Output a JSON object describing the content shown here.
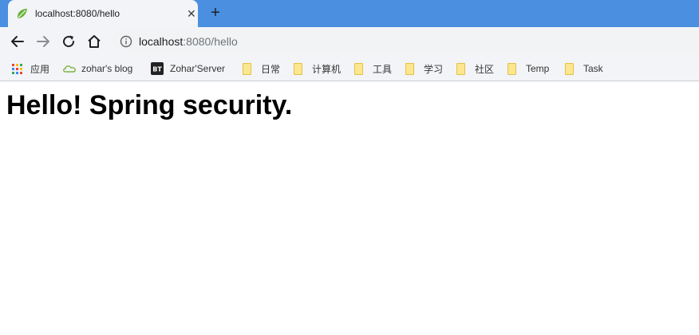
{
  "browser": {
    "tab": {
      "title": "localhost:8080/hello",
      "favicon": "spring-leaf-icon",
      "close_glyph": "✕"
    },
    "new_tab_glyph": "+",
    "toolbar": {
      "back": "arrow-left-icon",
      "forward": "arrow-right-icon",
      "reload": "reload-icon",
      "home": "home-icon"
    },
    "omnibox": {
      "host": "localhost",
      "rest": ":8080/hello",
      "info": "info-icon"
    },
    "bookmarks": [
      {
        "label": "应用",
        "icon": "apps-grid-icon"
      },
      {
        "label": "zohar's blog",
        "icon": "cloud-icon"
      },
      {
        "label": "Zohar'Server",
        "icon": "bt-icon"
      },
      {
        "label": "日常",
        "icon": "folder-icon"
      },
      {
        "label": "计算机",
        "icon": "folder-icon"
      },
      {
        "label": "工具",
        "icon": "folder-icon"
      },
      {
        "label": "学习",
        "icon": "folder-icon"
      },
      {
        "label": "社区",
        "icon": "folder-icon"
      },
      {
        "label": "Temp",
        "icon": "folder-icon"
      },
      {
        "label": "Task",
        "icon": "folder-icon"
      }
    ]
  },
  "colors": {
    "tabstrip": "#4a8fe0",
    "toolbar": "#f2f4f7",
    "folder": "#fce78f",
    "leaf": "#6db33f"
  },
  "page": {
    "heading": "Hello! Spring security."
  }
}
